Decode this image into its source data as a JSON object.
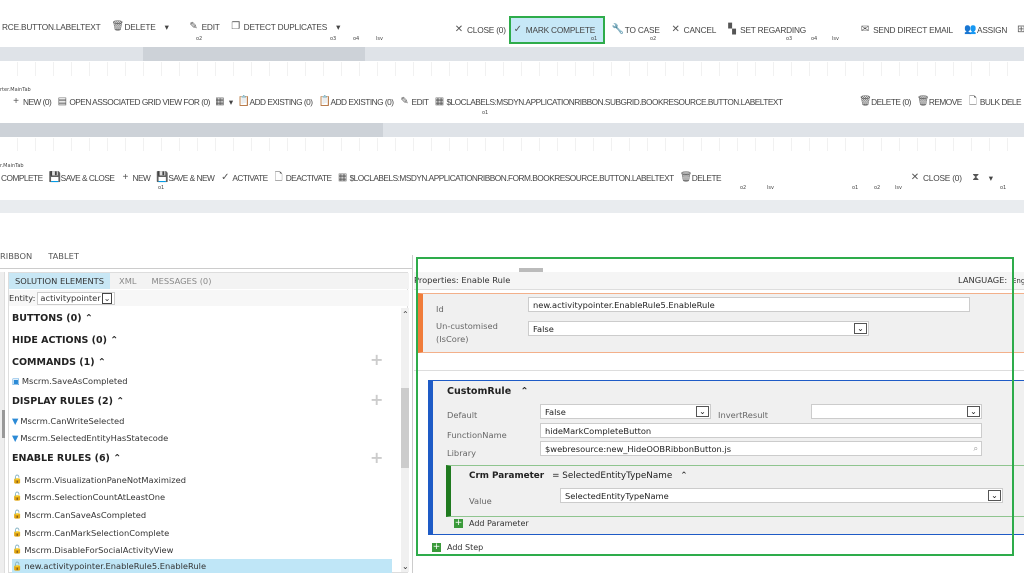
{
  "ribbon1": {
    "items": [
      {
        "label": "RCE.BUTTON.LABELTEXT",
        "icon": "none"
      },
      {
        "label": "DELETE",
        "icon": "trash-icon"
      },
      {
        "label": "EDIT",
        "icon": "pencil-icon"
      },
      {
        "label": "DETECT DUPLICATES",
        "icon": "duplicate-icon"
      },
      {
        "label": "CLOSE (0)",
        "icon": "close-icon"
      },
      {
        "label": "MARK COMPLETE",
        "icon": "check-icon"
      },
      {
        "label": "TO CASE",
        "icon": "wrench-icon"
      },
      {
        "label": "CANCEL",
        "icon": "close-icon"
      },
      {
        "label": "SET REGARDING",
        "icon": "regarding-icon"
      },
      {
        "label": "SEND DIRECT EMAIL",
        "icon": "email-icon"
      },
      {
        "label": "ASSIGN",
        "icon": "assign-icon"
      }
    ],
    "groups": [
      "o2",
      "o3",
      "o4",
      "lsv",
      "o1",
      "o2",
      "o3",
      "o4",
      "lsv",
      "o1"
    ]
  },
  "ribbon2": {
    "tab_label": "rter.MainTab",
    "items": [
      {
        "label": "NEW (0)"
      },
      {
        "label": "OPEN ASSOCIATED GRID VIEW FOR (0)"
      },
      {
        "label": "ADD EXISTING (0)"
      },
      {
        "label": "ADD EXISTING (0)"
      },
      {
        "label": "EDIT"
      },
      {
        "label": "$LOCLABELS:MSDYN.APPLICATIONRIBBON.SUBGRID.BOOKRESOURCE.BUTTON.LABELTEXT"
      },
      {
        "label": "DELETE (0)"
      },
      {
        "label": "REMOVE"
      },
      {
        "label": "BULK DELE"
      }
    ],
    "groups": [
      "o1"
    ]
  },
  "ribbon3": {
    "tab_label": "r.MainTab",
    "items": [
      {
        "label": "COMPLETE"
      },
      {
        "label": "SAVE & CLOSE"
      },
      {
        "label": "NEW"
      },
      {
        "label": "SAVE & NEW"
      },
      {
        "label": "ACTIVATE"
      },
      {
        "label": "DEACTIVATE"
      },
      {
        "label": "$LOCLABELS:MSDYN.APPLICATIONRIBBON.FORM.BOOKRESOURCE.BUTTON.LABELTEXT"
      },
      {
        "label": "DELETE"
      },
      {
        "label": "CLOSE (0)"
      }
    ],
    "groups": [
      "o1",
      "o2",
      "lsv",
      "o1",
      "o2",
      "lsv",
      "o1"
    ]
  },
  "view_tabs": [
    "RIBBON",
    "TABLET"
  ],
  "left_panel": {
    "tabs": [
      "SOLUTION ELEMENTS",
      "XML",
      "MESSAGES (0)"
    ],
    "entity_label": "Entity:",
    "entity_value": "activitypointer",
    "sections": [
      {
        "title": "BUTTONS (0)",
        "items": []
      },
      {
        "title": "HIDE ACTIONS (0)",
        "items": []
      },
      {
        "title": "COMMANDS (1)",
        "items": [
          "Mscrm.SaveAsCompleted"
        ]
      },
      {
        "title": "DISPLAY RULES (2)",
        "items": [
          "Mscrm.CanWriteSelected",
          "Mscrm.SelectedEntityHasStatecode"
        ]
      },
      {
        "title": "ENABLE RULES (6)",
        "items": [
          "Mscrm.VisualizationPaneNotMaximized",
          "Mscrm.SelectionCountAtLeastOne",
          "Mscrm.CanSaveAsCompleted",
          "Mscrm.CanMarkSelectionComplete",
          "Mscrm.DisableForSocialActivityView",
          "new.activitypointer.EnableRule5.EnableRule"
        ]
      }
    ]
  },
  "properties": {
    "title": "Properties: Enable Rule",
    "language_label": "LANGUAGE:",
    "language_value": "Eng",
    "id_label": "Id",
    "id_value": "new.activitypointer.EnableRule5.EnableRule",
    "uncust_label": "Un-customised",
    "uncust_label2": "(IsCore)",
    "uncust_value": "False",
    "custom_rule": {
      "title": "CustomRule",
      "default_label": "Default",
      "default_value": "False",
      "invert_label": "InvertResult",
      "invert_value": "",
      "function_label": "FunctionName",
      "function_value": "hideMarkCompleteButton",
      "library_label": "Library",
      "library_value": "$webresource:new_HideOOBRibbonButton.js",
      "param_title": "Crm Parameter",
      "param_eq": "= SelectedEntityTypeName",
      "value_label": "Value",
      "value_value": "SelectedEntityTypeName",
      "add_parameter": "Add Parameter"
    },
    "add_step": "Add Step"
  },
  "colors": {
    "highlight": "#2eac4b",
    "orange": "#f07c3a",
    "blue": "#1e5bc6",
    "green": "#1f7a1f",
    "selected": "#bfe6f7"
  }
}
